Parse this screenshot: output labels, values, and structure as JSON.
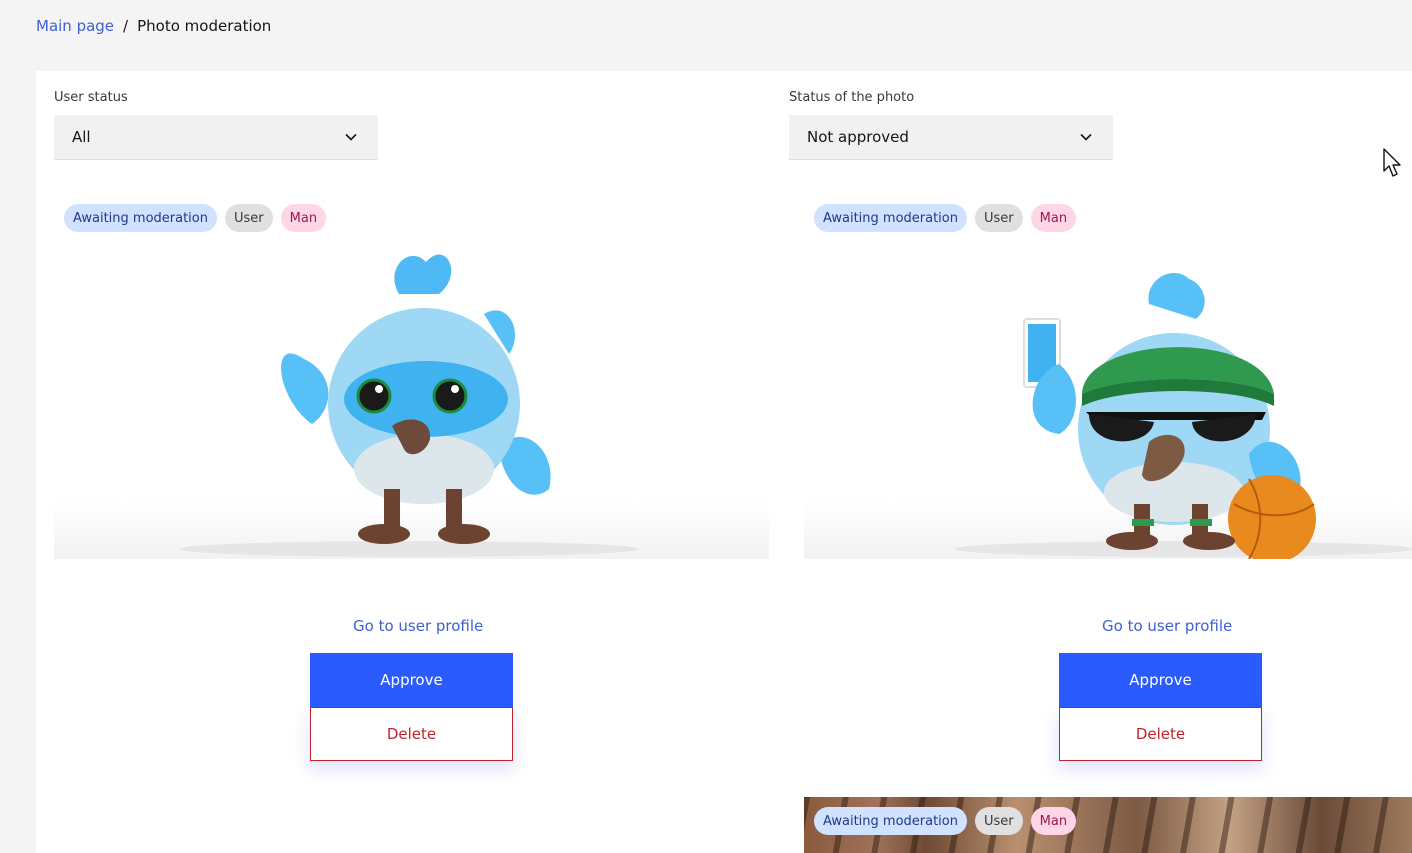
{
  "breadcrumb": {
    "home": "Main page",
    "separator": "/",
    "current": "Photo moderation"
  },
  "filters": {
    "user_status": {
      "label": "User status",
      "value": "All"
    },
    "photo_status": {
      "label": "Status of the photo",
      "value": "Not approved"
    }
  },
  "cards": [
    {
      "tags": {
        "status": "Awaiting moderation",
        "role": "User",
        "gender": "Man"
      },
      "profile_link": "Go to user profile",
      "approve": "Approve",
      "delete": "Delete"
    },
    {
      "tags": {
        "status": "Awaiting moderation",
        "role": "User",
        "gender": "Man"
      },
      "profile_link": "Go to user profile",
      "approve": "Approve",
      "delete": "Delete"
    },
    {
      "tags": {
        "status": "Awaiting moderation",
        "role": "User",
        "gender": "Man"
      }
    }
  ],
  "colors": {
    "link": "#3c5fd6",
    "approve_bg": "#2a5bff",
    "delete": "#c0222e",
    "tag_status_bg": "#d0e2ff",
    "tag_gender_bg": "#ffd6e8"
  }
}
